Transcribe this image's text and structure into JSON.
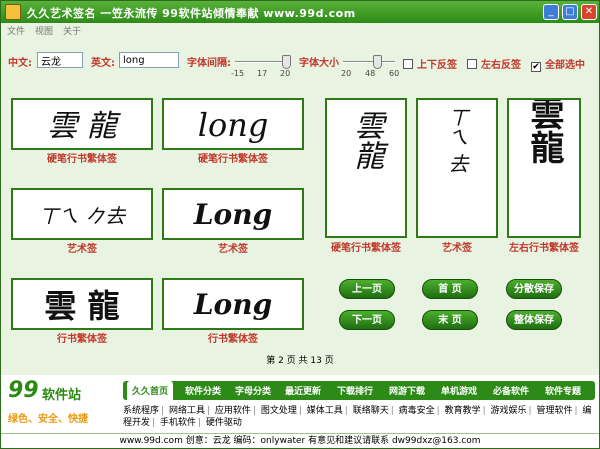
{
  "window": {
    "title": "久久艺术签名 一笠永流传 99软件站倾情奉献 www.99d.com",
    "controls": [
      "_",
      "□",
      "✕"
    ]
  },
  "menu": [
    "文件",
    "视图",
    "关于"
  ],
  "form": {
    "cn_label": "中文:",
    "cn_value": "云龙",
    "en_label": "英文:",
    "en_value": "long",
    "spacing_label": "字体间隔:",
    "spacing_ticks": [
      "-15",
      "17",
      "20"
    ],
    "spacing_level": 1.0,
    "size_label": "字体大小",
    "size_ticks": [
      "20",
      "48",
      "60"
    ],
    "size_level": 0.7,
    "check_flip_v": {
      "label": "上下反签",
      "checked": false
    },
    "check_flip_h": {
      "label": "左右反签",
      "checked": false
    },
    "check_all": {
      "label": "全部选中",
      "checked": true
    }
  },
  "previews": {
    "p1": {
      "glyph": "雲 龍",
      "caption": "硬笔行书繁体签"
    },
    "p2": {
      "glyph": "long",
      "caption": "硬笔行书繁体签"
    },
    "p3": {
      "glyph": "ㄒㄟ 𠂊去",
      "caption": "艺术签"
    },
    "p4": {
      "glyph": "Long",
      "caption": "艺术签"
    },
    "p5": {
      "glyph": "雲 龍",
      "caption": "行书繁体签"
    },
    "p6": {
      "glyph": "Long",
      "caption": "行书繁体签"
    },
    "v1": {
      "glyph": "雲龍",
      "caption": "硬笔行书繁体签"
    },
    "v2": {
      "glyph": "ㄒㄟ 去",
      "caption": "艺术签"
    },
    "v3": {
      "glyph": "雲龍",
      "caption": "左右行书繁体签"
    }
  },
  "buttons": {
    "prev": "上一页",
    "next": "下一页",
    "first": "首 页",
    "last": "末 页",
    "save_split": "分散保存",
    "save_whole": "整体保存"
  },
  "page_info": "第 2 页 共 13 页",
  "site": {
    "logo_big": "99",
    "logo_word": "软件站",
    "slogan": "绿色、安全、快捷",
    "tabs": [
      "久久首页",
      "软件分类",
      "字母分类",
      "最近更新",
      "下载排行",
      "网游下载",
      "单机游戏",
      "必备软件",
      "软件专题"
    ],
    "links": [
      "系统程序",
      "网络工具",
      "应用软件",
      "图文处理",
      "媒体工具",
      "联络聊天",
      "病毒安全",
      "教育教学",
      "游戏娱乐",
      "管理软件",
      "编程开发",
      "手机软件",
      "硬件驱动"
    ]
  },
  "footer": "www.99d.com 创意：云龙 编码：onlywater 有意见和建议请联系 dw99dxz@163.com"
}
